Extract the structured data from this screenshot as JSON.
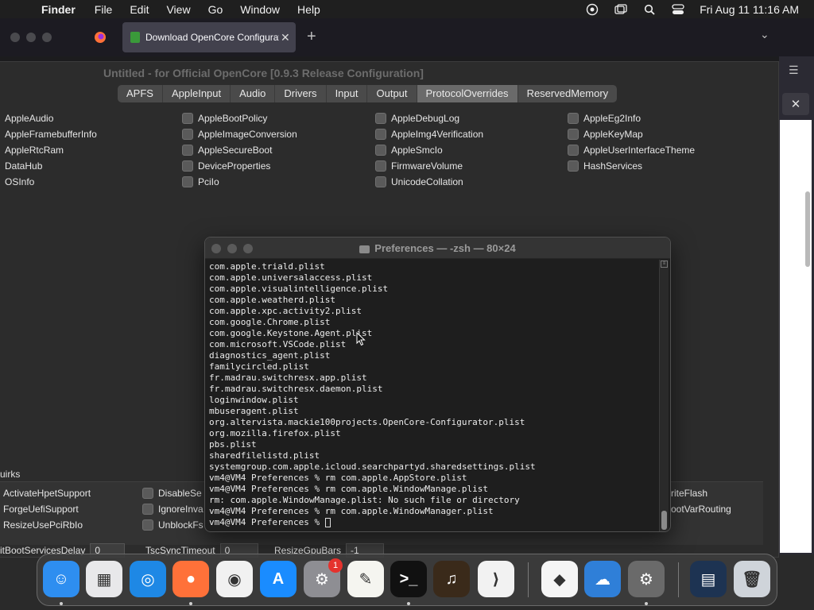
{
  "menubar": {
    "app_name": "Finder",
    "items": [
      "File",
      "Edit",
      "View",
      "Go",
      "Window",
      "Help"
    ],
    "clock": "Fri Aug 11  11:16 AM"
  },
  "browser": {
    "active_tab_title": "Download OpenCore Configurat",
    "close_glyph": "✕",
    "new_tab_glyph": "+",
    "tab_list_glyph": "⌄",
    "sidebar_menu_glyph": "☰",
    "sidebar_close_glyph": "✕"
  },
  "opencore": {
    "window_title": "Untitled - for Official OpenCore [0.9.3 Release Configuration]",
    "tabs": [
      {
        "label": "APFS"
      },
      {
        "label": "AppleInput"
      },
      {
        "label": "Audio"
      },
      {
        "label": "Drivers"
      },
      {
        "label": "Input"
      },
      {
        "label": "Output"
      },
      {
        "label": "ProtocolOverrides",
        "selected": true
      },
      {
        "label": "ReservedMemory"
      }
    ],
    "col1": [
      "AppleAudio",
      "AppleFramebufferInfo",
      "AppleRtcRam",
      "DataHub",
      "OSInfo"
    ],
    "col2": [
      "AppleBootPolicy",
      "AppleImageConversion",
      "AppleSecureBoot",
      "DeviceProperties",
      "PciIo"
    ],
    "col3": [
      "AppleDebugLog",
      "AppleImg4Verification",
      "AppleSmcIo",
      "FirmwareVolume",
      "UnicodeCollation"
    ],
    "col4": [
      "AppleEg2Info",
      "AppleKeyMap",
      "AppleUserInterfaceTheme",
      "HashServices"
    ],
    "quirks_label": "uirks",
    "quirks": {
      "left": [
        "ActivateHpetSupport",
        "ForgeUefiSupport",
        "ResizeUsePciRbIo"
      ],
      "mid": [
        "DisableSe",
        "IgnoreInva",
        "UnblockFs"
      ],
      "right": [
        "riteFlash",
        "ootVarRouting"
      ]
    },
    "fields": {
      "boot_services_label": "itBootServicesDelay",
      "boot_services_value": "0",
      "tsc_label": "TscSyncTimeout",
      "tsc_value": "0",
      "resize_label": "ResizeGpuBars",
      "resize_value": "-1"
    }
  },
  "terminal": {
    "title": "Preferences — -zsh — 80×24",
    "lines": [
      "com.apple.triald.plist",
      "com.apple.universalaccess.plist",
      "com.apple.visualintelligence.plist",
      "com.apple.weatherd.plist",
      "com.apple.xpc.activity2.plist",
      "com.google.Chrome.plist",
      "com.google.Keystone.Agent.plist",
      "com.microsoft.VSCode.plist",
      "diagnostics_agent.plist",
      "familycircled.plist",
      "fr.madrau.switchresx.app.plist",
      "fr.madrau.switchresx.daemon.plist",
      "loginwindow.plist",
      "mbuseragent.plist",
      "org.altervista.mackie100projects.OpenCore-Configurator.plist",
      "org.mozilla.firefox.plist",
      "pbs.plist",
      "sharedfilelistd.plist",
      "systemgroup.com.apple.icloud.searchpartyd.sharedsettings.plist",
      "vm4@VM4 Preferences % rm com.apple.AppStore.plist",
      "vm4@VM4 Preferences % rm com.apple.WindowManage.plist",
      "rm: com.apple.WindowManage.plist: No such file or directory",
      "vm4@VM4 Preferences % rm com.apple.WindowManager.plist",
      "vm4@VM4 Preferences % "
    ]
  },
  "dock": {
    "apps": [
      {
        "name": "Finder",
        "color": "#2e8ef0",
        "glyph": "☺"
      },
      {
        "name": "Launchpad",
        "color": "#e8e8ea",
        "glyph": "▦"
      },
      {
        "name": "Safari",
        "color": "#1e88e5",
        "glyph": "◎"
      },
      {
        "name": "Firefox",
        "color": "#ff7139",
        "glyph": "●"
      },
      {
        "name": "Chrome",
        "color": "#f1f1f1",
        "glyph": "◉"
      },
      {
        "name": "App Store",
        "color": "#1a8cff",
        "glyph": "A"
      },
      {
        "name": "System Settings",
        "color": "#8e8e93",
        "glyph": "⚙"
      },
      {
        "name": "TextEdit",
        "color": "#f5f5f0",
        "glyph": "✎"
      },
      {
        "name": "Terminal",
        "color": "#111111",
        "glyph": ">_"
      },
      {
        "name": "GarageBand",
        "color": "#3a2a1a",
        "glyph": "♫"
      },
      {
        "name": "VS Code",
        "color": "#f2f2f2",
        "glyph": "⟩"
      },
      {
        "name": "Visual Studio",
        "color": "#f5f5f5",
        "glyph": "◆"
      },
      {
        "name": "Weather",
        "color": "#2f7fd8",
        "glyph": "☁"
      },
      {
        "name": "OpenCore Configurator",
        "color": "#6a6a6a",
        "glyph": "⚙"
      },
      {
        "name": "Downloads",
        "color": "#1d3352",
        "glyph": "▤"
      },
      {
        "name": "Trash",
        "color": "#cfd4da",
        "glyph": "🗑"
      }
    ],
    "settings_badge": "1"
  }
}
